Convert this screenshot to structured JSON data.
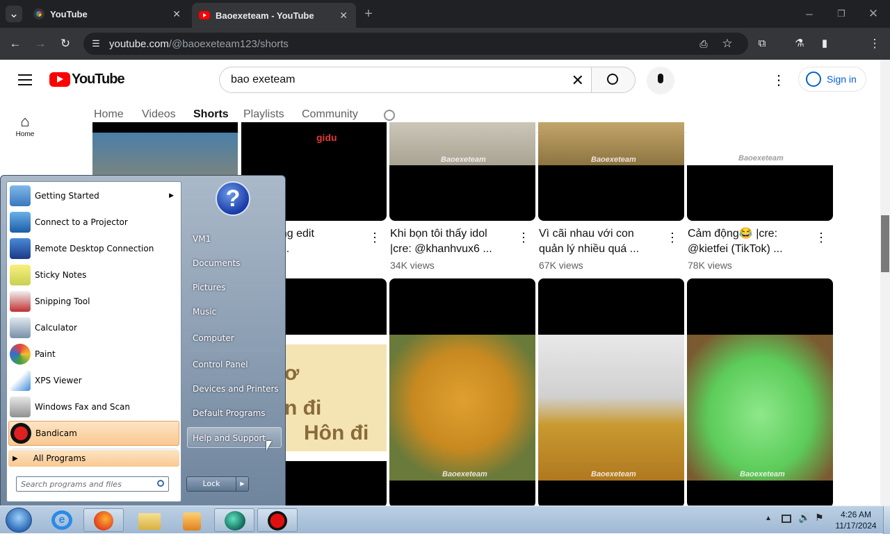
{
  "browser": {
    "tabs": [
      {
        "label": "YouTube",
        "active": false
      },
      {
        "label": "Baoexeteam - YouTube",
        "active": true
      }
    ],
    "url_host": "youtube.com",
    "url_path": "/@baoexeteam123/shorts"
  },
  "youtube": {
    "logo_text": "YouTube",
    "search_value": "bao exeteam",
    "sign_in": "Sign in",
    "sidebar": [
      {
        "label": "Home"
      }
    ],
    "channel_tabs": [
      "Home",
      "Videos",
      "Shorts",
      "Playlists",
      "Community"
    ],
    "active_tab": "Shorts",
    "row1": [
      {
        "title_line1": "",
        "title_line2": "",
        "views": ""
      },
      {
        "title_line1": "y đi nhưng edit",
        "title_line2": "tmotion ...",
        "views": ""
      },
      {
        "title_line1": "Khi bọn tôi thấy idol",
        "title_line2": "|cre: @khanhvux6 ...",
        "views": "34K views"
      },
      {
        "title_line1": "Vì cãi nhau với con",
        "title_line2": "quản lý nhiều quá ...",
        "views": "67K views"
      },
      {
        "title_line1": "Cảm động😂 |cre:",
        "title_line2": "@kietfei (TikTok) ...",
        "views": "78K views"
      }
    ],
    "watermark": "Baoexeteam",
    "thumb_text": {
      "line1": "ơ",
      "line2": "n đi",
      "line3": "Hôn đi"
    }
  },
  "start_menu": {
    "programs": [
      {
        "label": "Getting Started",
        "has_arrow": true,
        "icon": "getting-started-icon"
      },
      {
        "label": "Connect to a Projector",
        "icon": "projector-icon"
      },
      {
        "label": "Remote Desktop Connection",
        "icon": "remote-desktop-icon"
      },
      {
        "label": "Sticky Notes",
        "icon": "sticky-notes-icon"
      },
      {
        "label": "Snipping Tool",
        "icon": "snipping-tool-icon"
      },
      {
        "label": "Calculator",
        "icon": "calculator-icon"
      },
      {
        "label": "Paint",
        "icon": "paint-icon"
      },
      {
        "label": "XPS Viewer",
        "icon": "xps-viewer-icon"
      },
      {
        "label": "Windows Fax and Scan",
        "icon": "fax-scan-icon"
      },
      {
        "label": "Bandicam",
        "icon": "bandicam-icon"
      }
    ],
    "all_programs": "All Programs",
    "search_placeholder": "Search programs and files",
    "right_items": [
      "VM1",
      "Documents",
      "Pictures",
      "Music",
      "Computer",
      "Control Panel",
      "Devices and Printers",
      "Default Programs",
      "Help and Support"
    ],
    "lock": "Lock"
  },
  "taskbar": {
    "time": "4:26 AM",
    "date": "11/17/2024"
  }
}
